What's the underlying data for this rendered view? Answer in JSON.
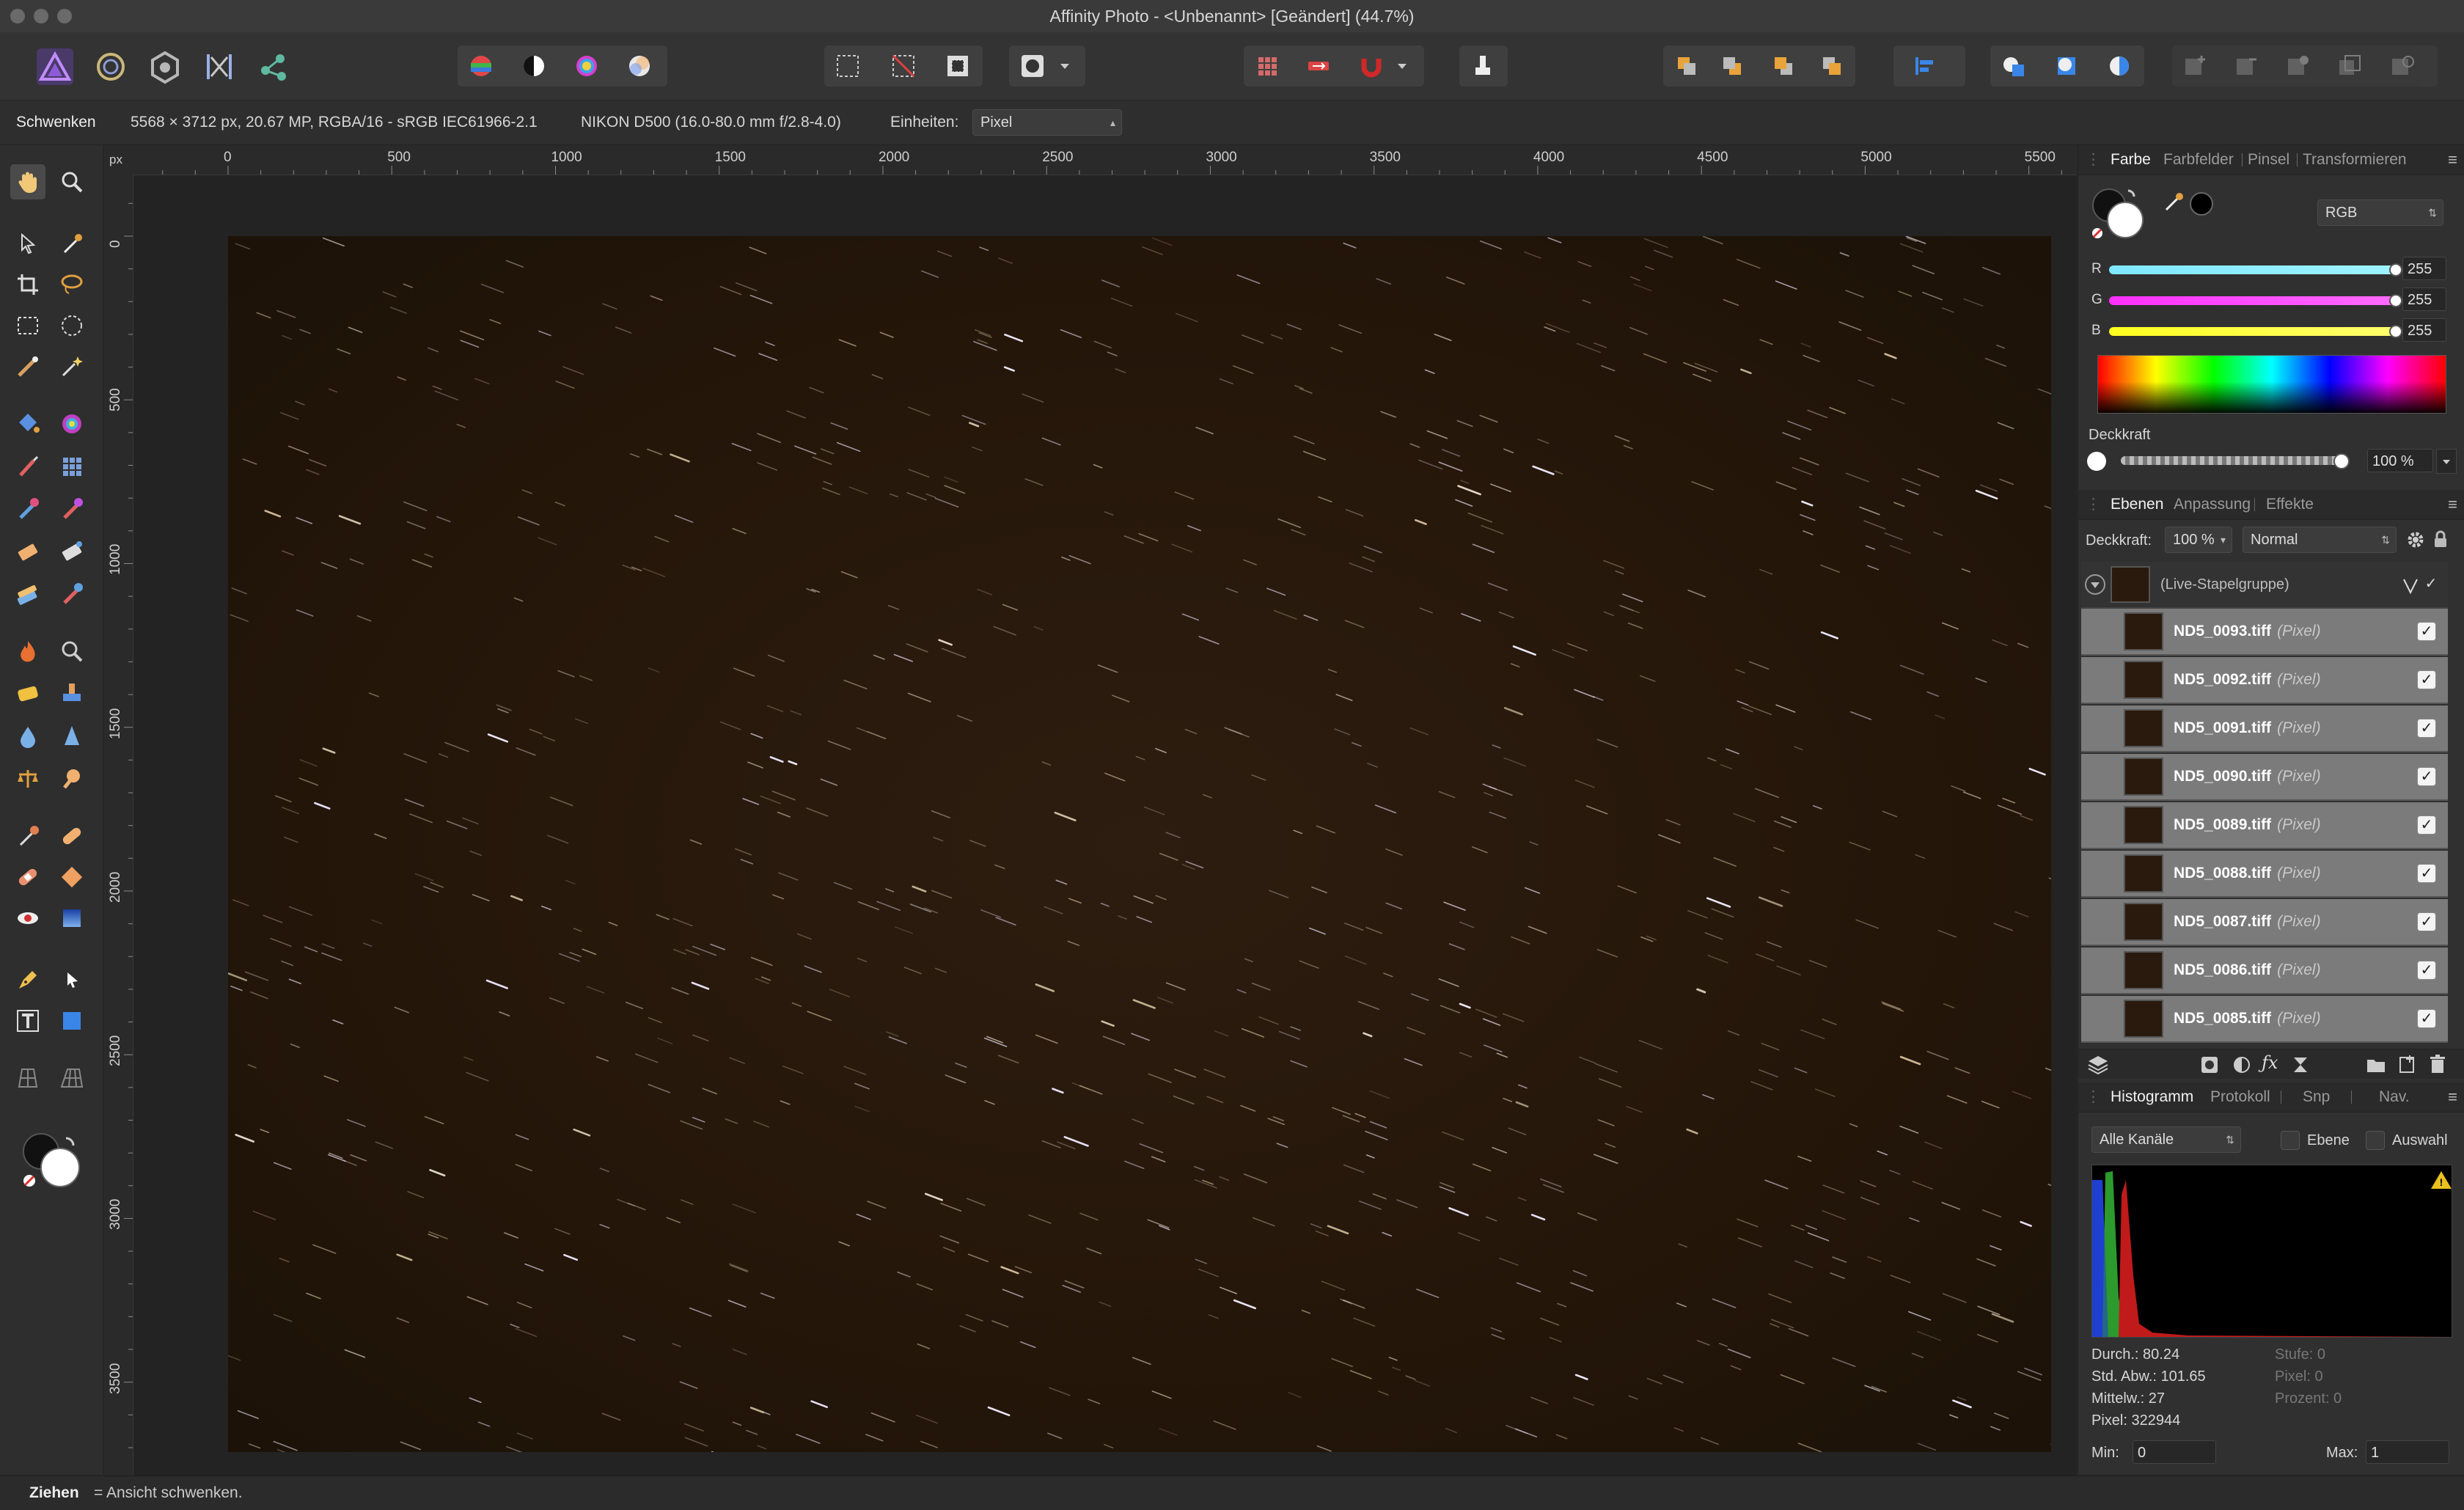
{
  "window": {
    "title": "Affinity Photo - <Unbenannt> [Geändert] (44.7%)"
  },
  "toolbar": {
    "personas": [
      "photo-persona",
      "liquify-persona",
      "develop-persona",
      "tone-mapping-persona",
      "export-persona"
    ],
    "groups": [
      "color-tools",
      "selection-tools",
      "quick-mask",
      "snapping",
      "context-toolbar",
      "arrange",
      "align",
      "boolean-ops",
      "layer-ops"
    ]
  },
  "context": {
    "tool": "Schwenken",
    "doc_info": "5568 × 3712 px, 20.67 MP, RGBA/16 - sRGB IEC61966-2.1",
    "camera": "NIKON D500 (16.0-80.0 mm f/2.8-4.0)",
    "units_label": "Einheiten:",
    "units_value": "Pixel"
  },
  "ruler": {
    "unit": "px",
    "top_labels": [
      "0",
      "500",
      "1000",
      "1500",
      "2000",
      "2500",
      "3000",
      "3500",
      "4000",
      "4500",
      "5000",
      "5500"
    ],
    "left_labels": [
      "0",
      "500",
      "1000",
      "1500",
      "2000",
      "2500",
      "3000",
      "3500"
    ]
  },
  "color_panel": {
    "tabs": [
      "Farbe",
      "Farbfelder",
      "Pinsel",
      "Transformieren"
    ],
    "mode": "RGB",
    "r_label": "R",
    "r_value": "255",
    "g_label": "G",
    "g_value": "255",
    "b_label": "B",
    "b_value": "255",
    "opacity_label": "Deckkraft",
    "opacity_value": "100 %"
  },
  "layers_panel": {
    "tabs": [
      "Ebenen",
      "Anpassung",
      "Effekte"
    ],
    "opacity_label": "Deckkraft:",
    "opacity_value": "100 %",
    "blend_mode": "Normal",
    "group_name": "(Live-Stapelgruppe)",
    "layers": [
      {
        "name": "ND5_0093.tiff",
        "kind": "(Pixel)"
      },
      {
        "name": "ND5_0092.tiff",
        "kind": "(Pixel)"
      },
      {
        "name": "ND5_0091.tiff",
        "kind": "(Pixel)"
      },
      {
        "name": "ND5_0090.tiff",
        "kind": "(Pixel)"
      },
      {
        "name": "ND5_0089.tiff",
        "kind": "(Pixel)"
      },
      {
        "name": "ND5_0088.tiff",
        "kind": "(Pixel)"
      },
      {
        "name": "ND5_0087.tiff",
        "kind": "(Pixel)"
      },
      {
        "name": "ND5_0086.tiff",
        "kind": "(Pixel)"
      },
      {
        "name": "ND5_0085.tiff",
        "kind": "(Pixel)"
      }
    ]
  },
  "histogram_panel": {
    "tabs": [
      "Histogramm",
      "Protokoll",
      "Snp",
      "Nav."
    ],
    "channel": "Alle Kanäle",
    "layer_label": "Ebene",
    "selection_label": "Auswahl",
    "stats": {
      "mean": "Durch.: 80.24",
      "std": "Std. Abw.: 101.65",
      "median": "Mittelw.: 27",
      "pixels": "Pixel: 322944",
      "level": "Stufe: 0",
      "count": "Pixel: 0",
      "percent": "Prozent: 0"
    },
    "min_label": "Min:",
    "min_value": "0",
    "max_label": "Max:",
    "max_value": "1"
  },
  "status": {
    "bold": "Ziehen",
    "text": " = Ansicht schwenken."
  },
  "colors": {
    "accent": "#2f7ad6",
    "photo_bg": "#241609",
    "panel": "#303030"
  }
}
